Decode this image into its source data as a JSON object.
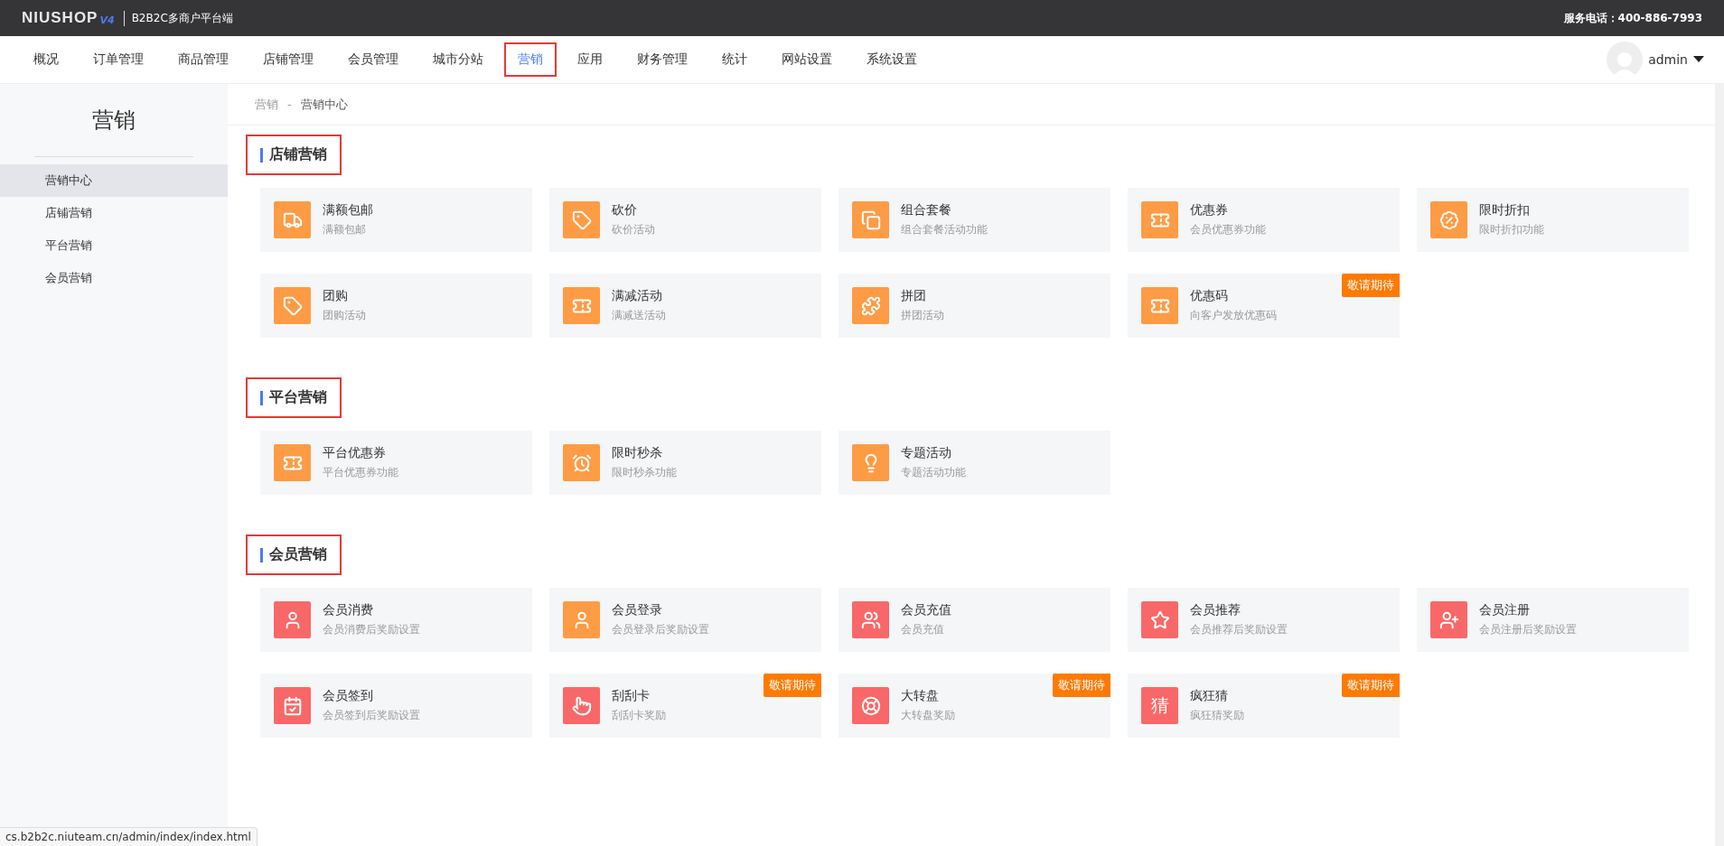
{
  "top_bar": {
    "logo": "NIUSHOP",
    "logo_version": "V4",
    "platform": "B2B2C多商户平台端",
    "hotline": "服务电话：400-886-7993"
  },
  "nav": {
    "items": [
      {
        "label": "概况",
        "selected": false,
        "highlighted": false
      },
      {
        "label": "订单管理",
        "selected": false,
        "highlighted": false
      },
      {
        "label": "商品管理",
        "selected": false,
        "highlighted": false
      },
      {
        "label": "店铺管理",
        "selected": false,
        "highlighted": false
      },
      {
        "label": "会员管理",
        "selected": false,
        "highlighted": false
      },
      {
        "label": "城市分站",
        "selected": false,
        "highlighted": false
      },
      {
        "label": "营销",
        "selected": true,
        "highlighted": true
      },
      {
        "label": "应用",
        "selected": false,
        "highlighted": false
      },
      {
        "label": "财务管理",
        "selected": false,
        "highlighted": false
      },
      {
        "label": "统计",
        "selected": false,
        "highlighted": false
      },
      {
        "label": "网站设置",
        "selected": false,
        "highlighted": false
      },
      {
        "label": "系统设置",
        "selected": false,
        "highlighted": false
      }
    ],
    "user": "admin"
  },
  "sidebar": {
    "title": "营销",
    "items": [
      {
        "label": "营销中心",
        "selected": true
      },
      {
        "label": "店铺营销",
        "selected": false
      },
      {
        "label": "平台营销",
        "selected": false
      },
      {
        "label": "会员营销",
        "selected": false
      }
    ]
  },
  "breadcrumb": [
    "营销",
    "-",
    "营销中心"
  ],
  "sections": [
    {
      "title": "店铺营销",
      "highlighted": true,
      "cards": [
        {
          "title": "满额包邮",
          "desc": "满额包邮",
          "kind": "truck",
          "color": "#fe9b45"
        },
        {
          "title": "砍价",
          "desc": "砍价活动",
          "kind": "tag",
          "color": "#fe9b45"
        },
        {
          "title": "组合套餐",
          "desc": "组合套餐活动功能",
          "kind": "stack",
          "color": "#fe9b45"
        },
        {
          "title": "优惠券",
          "desc": "会员优惠券功能",
          "kind": "ticket",
          "color": "#fe9b45"
        },
        {
          "title": "限时折扣",
          "desc": "限时折扣功能",
          "kind": "percent",
          "color": "#fe9b45"
        },
        {
          "title": "团购",
          "desc": "团购活动",
          "kind": "tag",
          "color": "#fe9b45"
        },
        {
          "title": "满减活动",
          "desc": "满减送活动",
          "kind": "ticket",
          "color": "#fe9b45"
        },
        {
          "title": "拼团",
          "desc": "拼团活动",
          "kind": "puzzle",
          "color": "#fe9b45"
        },
        {
          "title": "优惠码",
          "desc": "向客户发放优惠码",
          "kind": "ticket",
          "color": "#fe9b45",
          "badge": "敬请期待"
        }
      ]
    },
    {
      "title": "平台营销",
      "highlighted": true,
      "cards": [
        {
          "title": "平台优惠券",
          "desc": "平台优惠券功能",
          "kind": "ticket",
          "color": "#fe9b45"
        },
        {
          "title": "限时秒杀",
          "desc": "限时秒杀功能",
          "kind": "alarm",
          "color": "#fe9b45"
        },
        {
          "title": "专题活动",
          "desc": "专题活动功能",
          "kind": "bulb",
          "color": "#fe9b45"
        }
      ]
    },
    {
      "title": "会员营销",
      "highlighted": true,
      "cards": [
        {
          "title": "会员消费",
          "desc": "会员消费后奖励设置",
          "kind": "user",
          "color": "#f96868"
        },
        {
          "title": "会员登录",
          "desc": "会员登录后奖励设置",
          "kind": "user",
          "color": "#fe9b45"
        },
        {
          "title": "会员充值",
          "desc": "会员充值",
          "kind": "users",
          "color": "#f96868"
        },
        {
          "title": "会员推荐",
          "desc": "会员推荐后奖励设置",
          "kind": "star",
          "color": "#f96868"
        },
        {
          "title": "会员注册",
          "desc": "会员注册后奖励设置",
          "kind": "userplus",
          "color": "#f96868"
        },
        {
          "title": "会员签到",
          "desc": "会员签到后奖励设置",
          "kind": "calendar",
          "color": "#f96868"
        },
        {
          "title": "刮刮卡",
          "desc": "刮刮卡奖励",
          "kind": "pointer",
          "color": "#f96868",
          "badge": "敬请期待"
        },
        {
          "title": "大转盘",
          "desc": "大转盘奖励",
          "kind": "wheel",
          "color": "#f96868",
          "badge": "敬请期待"
        },
        {
          "title": "疯狂猜",
          "desc": "疯狂猜奖励",
          "kind": "glyph",
          "glyph": "猜",
          "color": "#f96868",
          "badge": "敬请期待"
        }
      ]
    }
  ],
  "status_url": "cs.b2b2c.niuteam.cn/admin/index/index.html"
}
